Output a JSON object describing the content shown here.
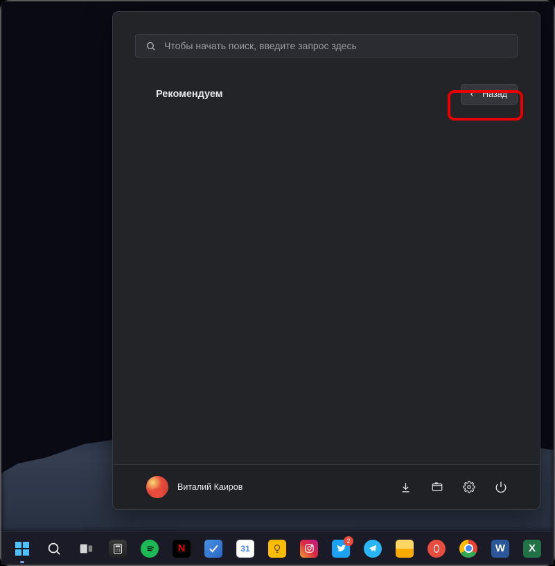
{
  "search": {
    "placeholder": "Чтобы начать поиск, введите запрос здесь"
  },
  "section": {
    "title": "Рекомендуем",
    "back_label": "Назад"
  },
  "user": {
    "name": "Виталий Каиров"
  },
  "taskbar": {
    "calendar_day": "31",
    "twitter_badge": "2"
  }
}
